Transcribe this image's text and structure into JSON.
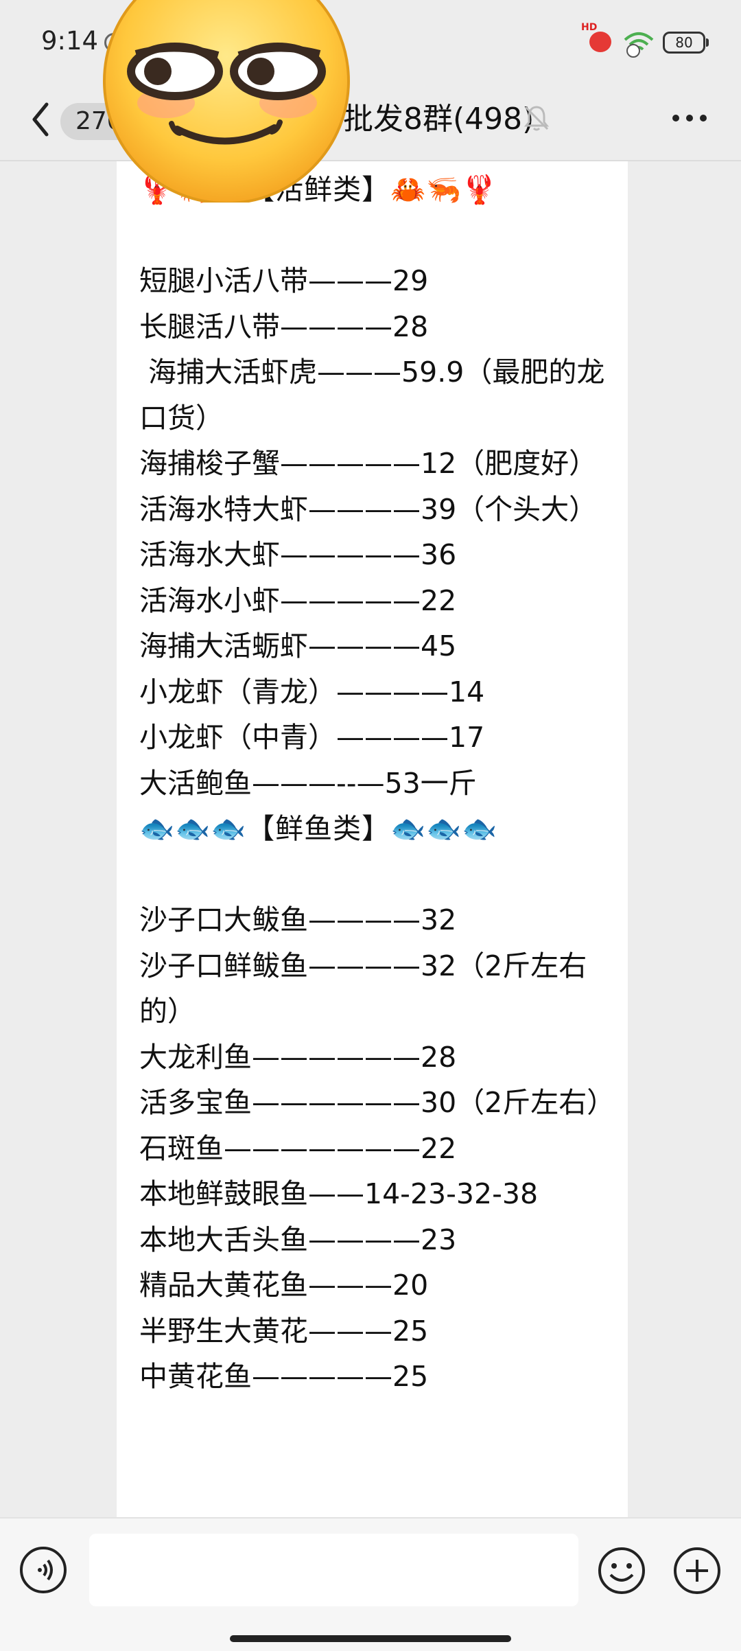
{
  "status": {
    "time": "9:14",
    "battery": "80",
    "signal_badge": "HD"
  },
  "header": {
    "unread_count": "270",
    "title": "批发8群(498)"
  },
  "message": {
    "lines": [
      "🦞🦐🦀【活鲜类】🦀🦐🦞",
      "",
      "短腿小活八带———29",
      "长腿活八带————28",
      " 海捕大活虾虎———59.9（最肥的龙口货）",
      "海捕梭子蟹—————12（肥度好）",
      "活海水特大虾————39（个头大）",
      "活海水大虾—————36",
      "活海水小虾—————22",
      "海捕大活蛎虾————45",
      "小龙虾（青龙）————14",
      "小龙虾（中青）————17",
      "大活鲍鱼———--—53一斤",
      "🐟🐟🐟【鲜鱼类】🐟🐟🐟",
      "",
      "沙子口大鲅鱼————32",
      "沙子口鲜鲅鱼————32（2斤左右的）",
      "大龙利鱼——————28",
      "活多宝鱼——————30（2斤左右）",
      "石斑鱼———————22",
      "本地鲜鼓眼鱼——14-23-32-38",
      "本地大舌头鱼————23",
      "精品大黄花鱼———20",
      "半野生大黄花———25",
      "中黄花鱼—————25"
    ]
  },
  "colors": {
    "background": "#ededed",
    "bubble": "#ffffff",
    "text": "#111111"
  },
  "icons": [
    "back-arrow-icon",
    "mute-bell-icon",
    "more-dots-icon",
    "voice-icon",
    "emoji-icon",
    "plus-icon",
    "smirk-emoji-sticker"
  ]
}
